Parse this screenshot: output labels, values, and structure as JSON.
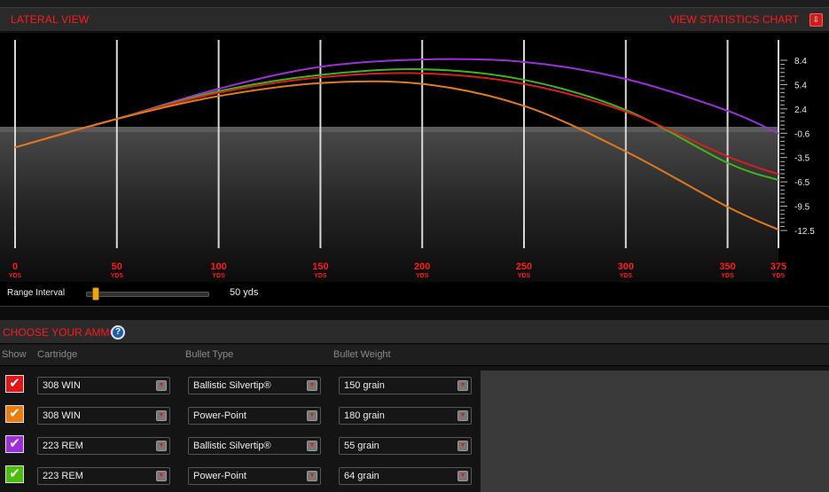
{
  "header": {
    "title": "LATERAL VIEW",
    "stats_link": "VIEW STATISTICS CHART",
    "stats_icon": "download-arrow-icon"
  },
  "chart_data": {
    "type": "line",
    "xlabel": "",
    "ylabel": "",
    "x_ticks": [
      0,
      50,
      100,
      150,
      200,
      250,
      300,
      350,
      375
    ],
    "x_tick_labels": [
      "0",
      "50",
      "100",
      "150",
      "200",
      "250",
      "300",
      "350",
      "375"
    ],
    "x_unit_label": "YDS",
    "y_ticks": [
      8.4,
      5.4,
      2.4,
      -0.6,
      -3.5,
      -6.5,
      -9.5,
      -12.5
    ],
    "y_tick_labels": [
      "8.4",
      "5.4",
      "2.4",
      "-0.6",
      "-3.5",
      "-6.5",
      "-9.5",
      "-12.5"
    ],
    "xlim": [
      0,
      375
    ],
    "ylim": [
      -12.5,
      8.4
    ],
    "grid": true,
    "series": [
      {
        "color": "#9b30d9",
        "x": [
          0,
          50,
          100,
          150,
          200,
          250,
          300,
          350,
          375
        ],
        "y": [
          -2.3,
          1.2,
          4.9,
          7.6,
          8.5,
          8.2,
          6.1,
          2.2,
          -0.6
        ]
      },
      {
        "color": "#3fb617",
        "x": [
          0,
          50,
          100,
          150,
          200,
          250,
          300,
          350,
          375
        ],
        "y": [
          -2.3,
          1.2,
          4.6,
          6.6,
          7.3,
          6.0,
          2.3,
          -4.2,
          -6.3
        ]
      },
      {
        "color": "#d81e1e",
        "x": [
          0,
          50,
          100,
          150,
          200,
          250,
          300,
          350,
          375
        ],
        "y": [
          -2.3,
          1.2,
          4.4,
          6.3,
          6.8,
          5.5,
          2.1,
          -3.4,
          -5.6
        ]
      },
      {
        "color": "#e07b1c",
        "x": [
          0,
          50,
          100,
          150,
          200,
          250,
          300,
          350,
          375
        ],
        "y": [
          -2.3,
          1.2,
          4.0,
          5.6,
          5.5,
          2.8,
          -2.8,
          -9.6,
          -12.4
        ]
      }
    ]
  },
  "range": {
    "label": "Range Interval",
    "value": "50 yds",
    "slider_fraction": 0.05
  },
  "ammo": {
    "title": "CHOOSE YOUR AMMO",
    "help_icon": "question-mark-icon",
    "columns": {
      "show": "Show",
      "cartridge": "Cartridge",
      "bullet_type": "Bullet Type",
      "bullet_weight": "Bullet Weight"
    },
    "rows": [
      {
        "color": "#e01616",
        "checked": true,
        "cartridge": "308 WIN",
        "bullet_type": "Ballistic Silvertip®",
        "bullet_weight": "150 grain"
      },
      {
        "color": "#ea7d10",
        "checked": true,
        "cartridge": "308 WIN",
        "bullet_type": "Power-Point",
        "bullet_weight": "180 grain"
      },
      {
        "color": "#9b30d9",
        "checked": true,
        "cartridge": "223 REM",
        "bullet_type": "Ballistic Silvertip®",
        "bullet_weight": "55 grain"
      },
      {
        "color": "#4bbf10",
        "checked": true,
        "cartridge": "223 REM",
        "bullet_type": "Power-Point",
        "bullet_weight": "64 grain"
      }
    ],
    "checkmark_icon": "checkmark-icon",
    "dropdown_icon": "dropdown-arrow-icon"
  }
}
